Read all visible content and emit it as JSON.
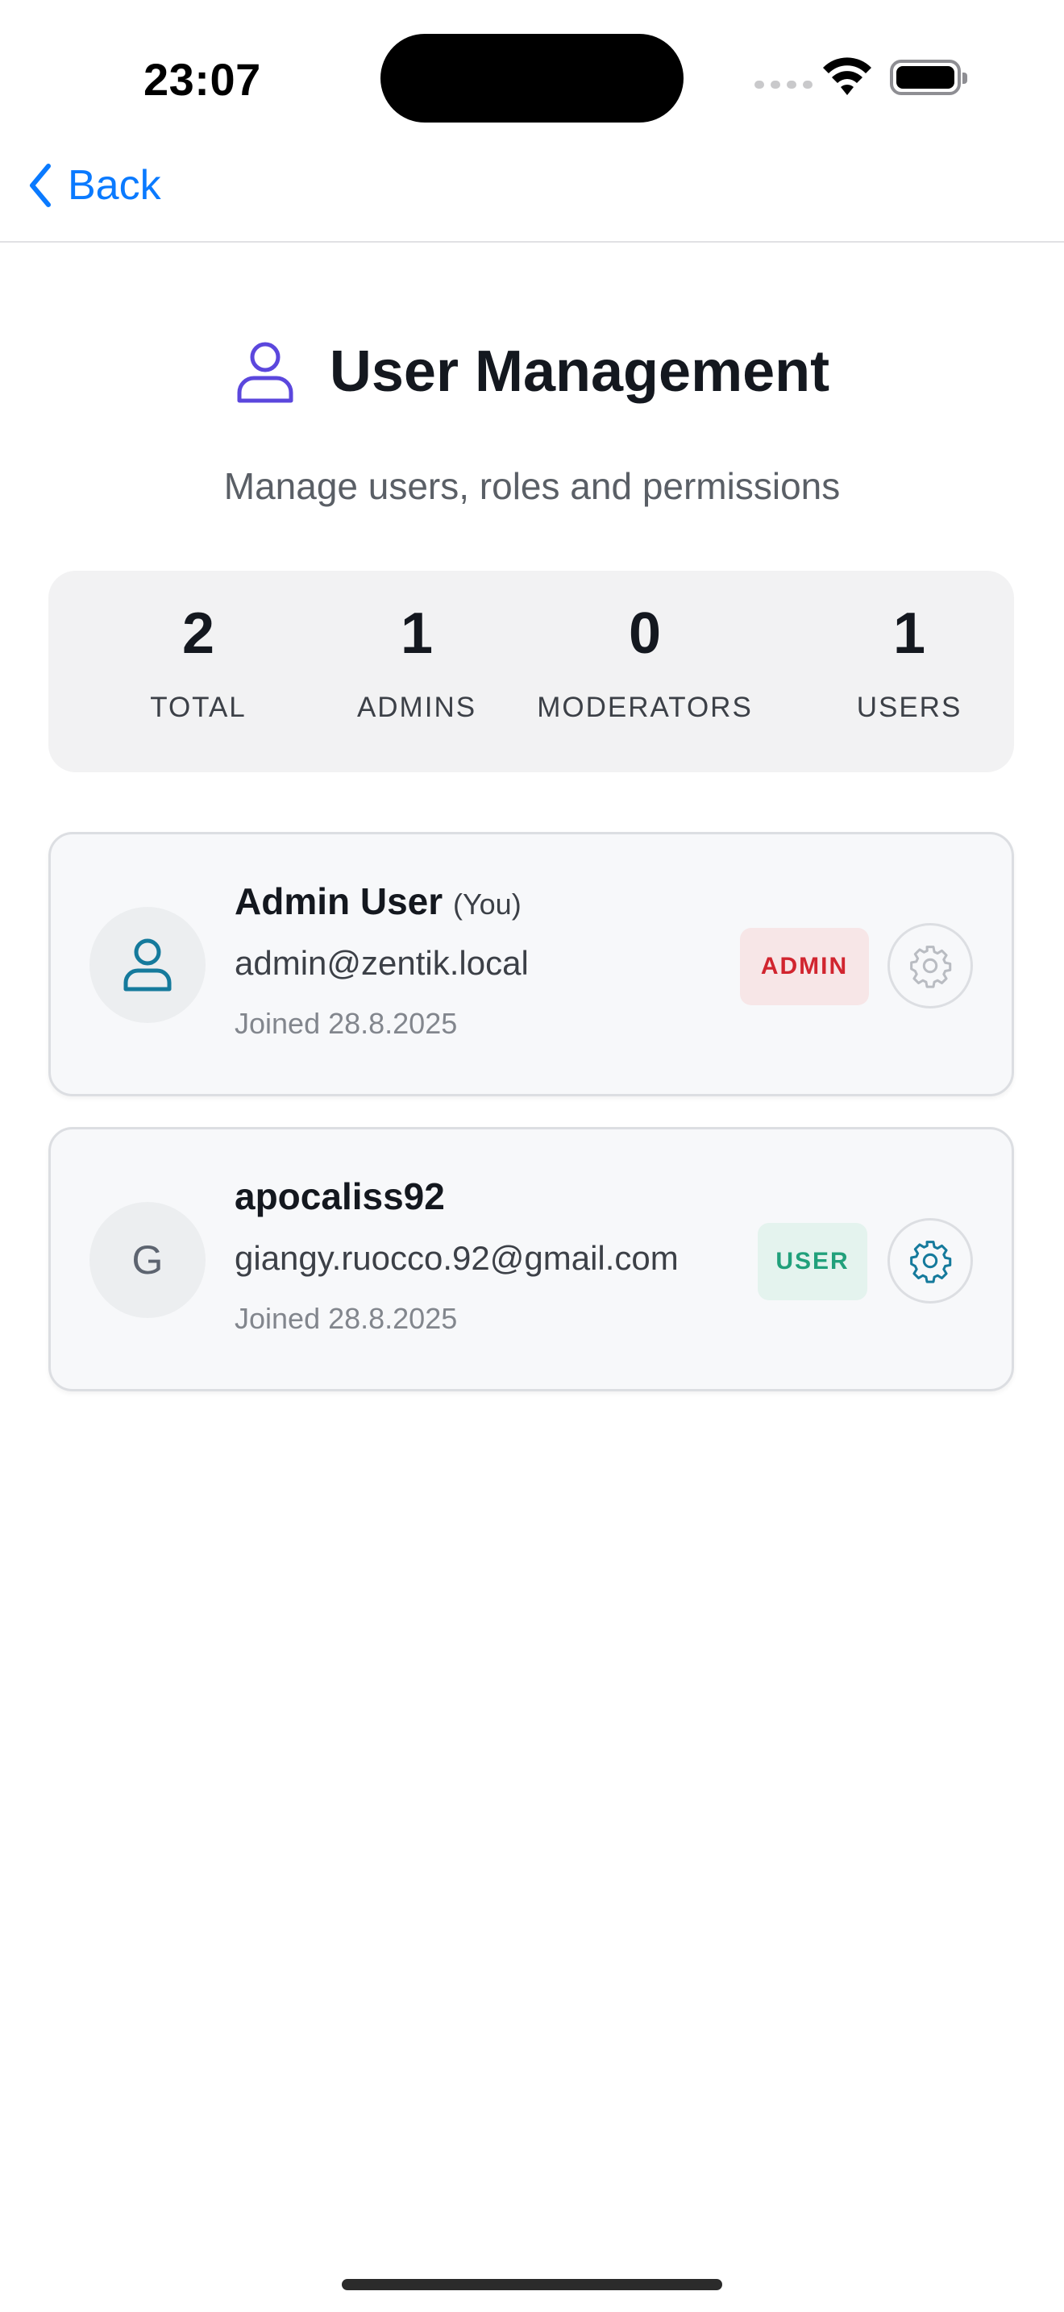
{
  "status_bar": {
    "time": "23:07"
  },
  "nav": {
    "back_label": "Back"
  },
  "header": {
    "title": "User Management",
    "subtitle": "Manage users, roles and permissions"
  },
  "stats": [
    {
      "value": "2",
      "label": "TOTAL"
    },
    {
      "value": "1",
      "label": "ADMINS"
    },
    {
      "value": "0",
      "label": "MODERATORS"
    },
    {
      "value": "1",
      "label": "USERS"
    }
  ],
  "users": [
    {
      "name": "Admin User",
      "you_tag": "(You)",
      "email": "admin@zentik.local",
      "joined": "Joined 28.8.2025",
      "role": "ADMIN",
      "avatar_icon": "person-icon",
      "settings_enabled": false
    },
    {
      "name": "apocaliss92",
      "avatar_letter": "G",
      "email": "giangy.ruocco.92@gmail.com",
      "joined": "Joined 28.8.2025",
      "role": "USER",
      "settings_enabled": true
    }
  ],
  "colors": {
    "accent_blue": "#0a7aff",
    "title_icon": "#5b47dd",
    "teal": "#157a9c",
    "admin_badge_text": "#d1252f",
    "user_badge_text": "#21a07b"
  }
}
